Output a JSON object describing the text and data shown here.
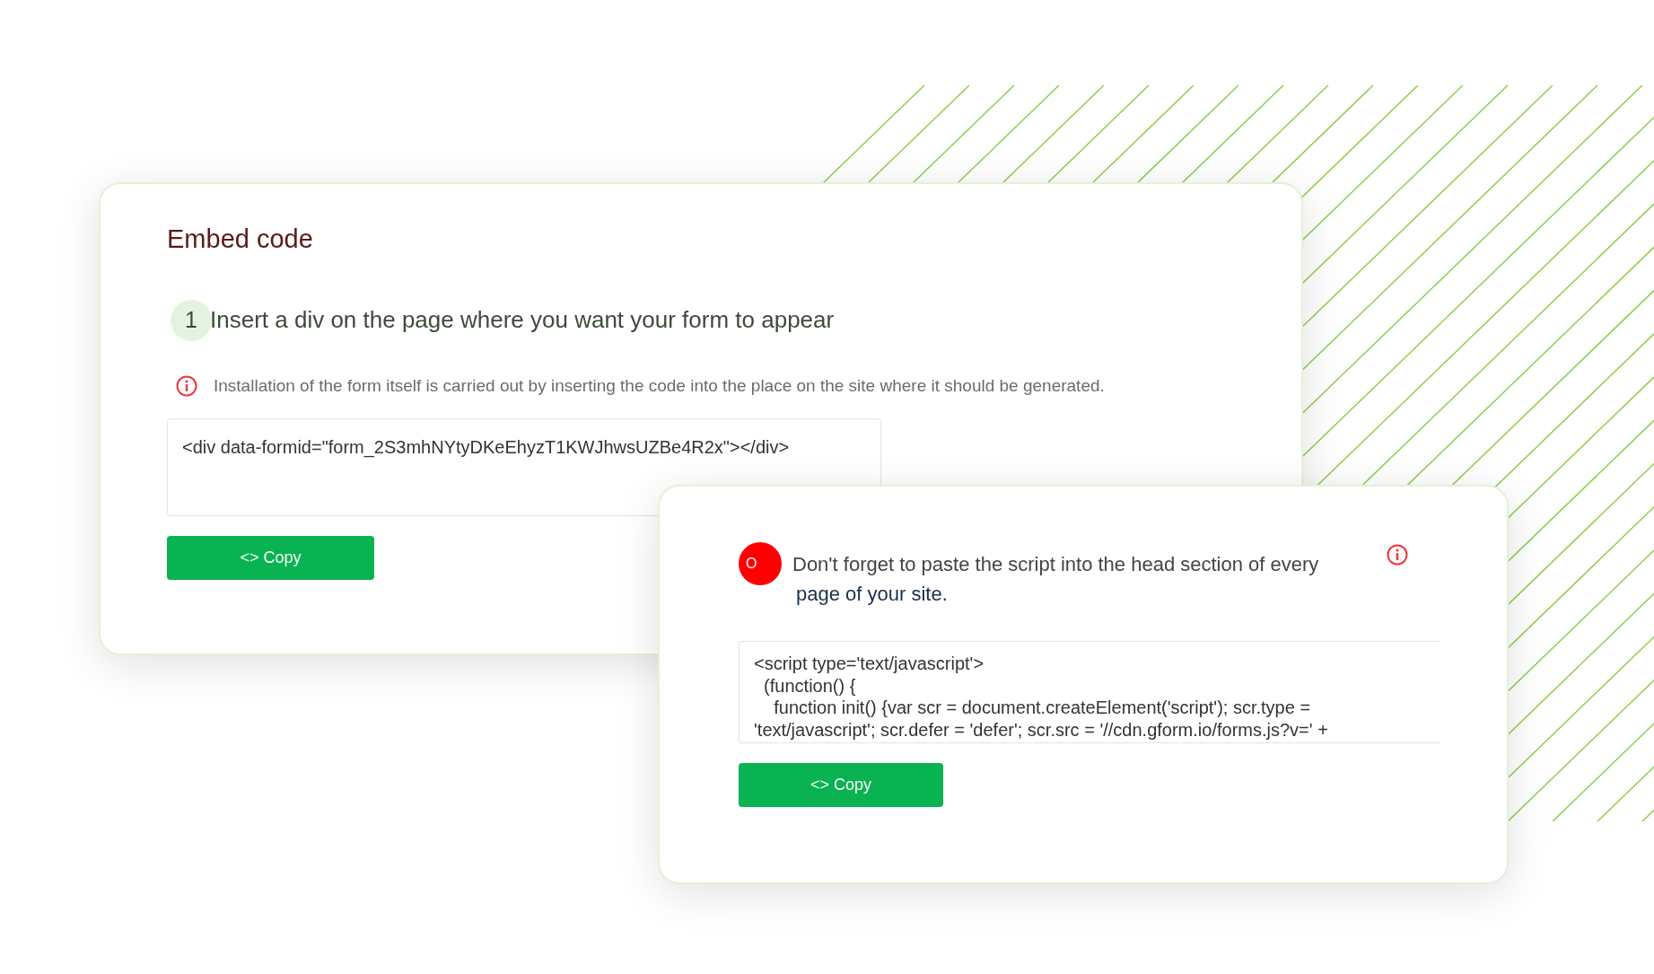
{
  "embed_card": {
    "title": "Embed code",
    "step": {
      "number": "1",
      "text": "Insert a div on the page where you want your form to appear"
    },
    "info": "Installation of the form itself is carried out by inserting the code into the place on the site where it should be generated.",
    "code": [
      "<div data-formid=\"form_2S3mhNYtyDKeEhyzT1KWJhwsUZBe4R2x\"></div>"
    ],
    "button": "<> Copy"
  },
  "script_card": {
    "badge": "O",
    "notice": [
      "Don't forget to paste the script into the head section of every",
      "page of your site."
    ],
    "code": [
      "<script type='text/javascript'>",
      "  (function() {",
      "    function init() {var scr = document.createElement('script'); scr.type =",
      "'text/javascript'; scr.defer = 'defer'; scr.src = '//cdn.gform.io/forms.js?v=' +"
    ],
    "button": "<> Copy"
  }
}
